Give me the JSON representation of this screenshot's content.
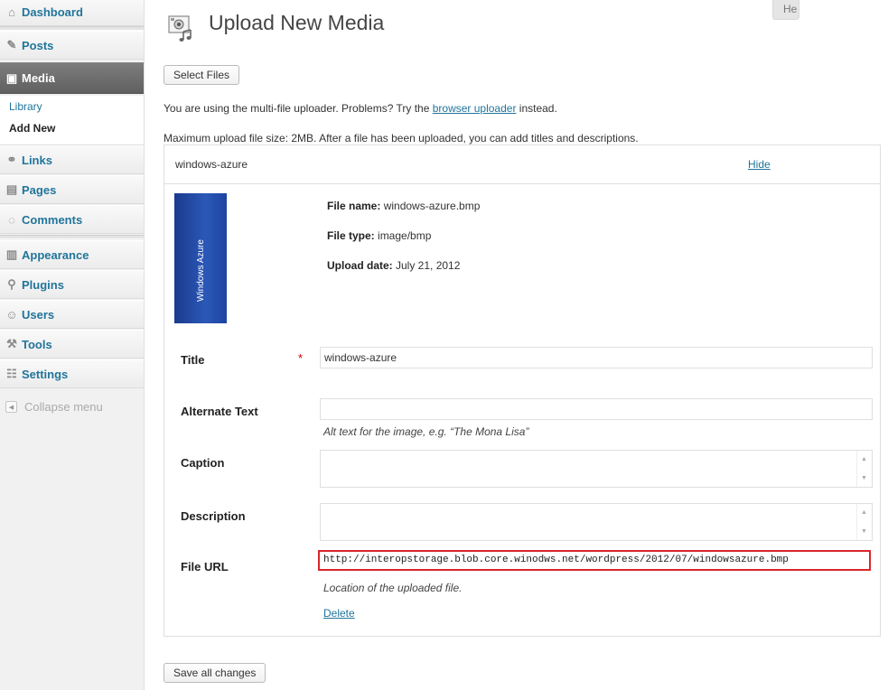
{
  "sidebar": {
    "dashboard": "Dashboard",
    "posts": "Posts",
    "media": "Media",
    "library": "Library",
    "add_new": "Add New",
    "links": "Links",
    "pages": "Pages",
    "comments": "Comments",
    "appearance": "Appearance",
    "plugins": "Plugins",
    "users": "Users",
    "tools": "Tools",
    "settings": "Settings",
    "collapse": "Collapse menu"
  },
  "header": {
    "help_tab": "He",
    "title": "Upload New Media",
    "select_files": "Select Files"
  },
  "info": {
    "uploader_prefix": "You are using the multi-file uploader. Problems? Try the ",
    "uploader_link": "browser uploader",
    "uploader_suffix": " instead.",
    "max_size": "Maximum upload file size: 2MB. After a file has been uploaded, you can add titles and descriptions."
  },
  "file": {
    "name_header": "windows-azure",
    "hide_link": "Hide",
    "thumb_text": "Windows Azure",
    "meta": {
      "name_label": "File name:",
      "name_value": " windows-azure.bmp",
      "type_label": "File type:",
      "type_value": " image/bmp",
      "date_label": "Upload date:",
      "date_value": " July 21, 2012"
    },
    "fields": {
      "title_label": "Title",
      "required_mark": "*",
      "title_value": "windows-azure",
      "alt_label": "Alternate Text",
      "alt_value": "",
      "alt_hint": "Alt text for the image, e.g. “The Mona Lisa”",
      "caption_label": "Caption",
      "description_label": "Description",
      "url_label": "File URL",
      "url_value": "http://interopstorage.blob.core.winodws.net/wordpress/2012/07/windowsazure.bmp",
      "url_hint": "Location of the uploaded file.",
      "delete_link": "Delete"
    }
  },
  "footer": {
    "save_all": "Save all changes"
  },
  "colors": {
    "link": "#21759b",
    "highlight_border": "#d9262b",
    "active_menu": "#6d6d6d"
  }
}
